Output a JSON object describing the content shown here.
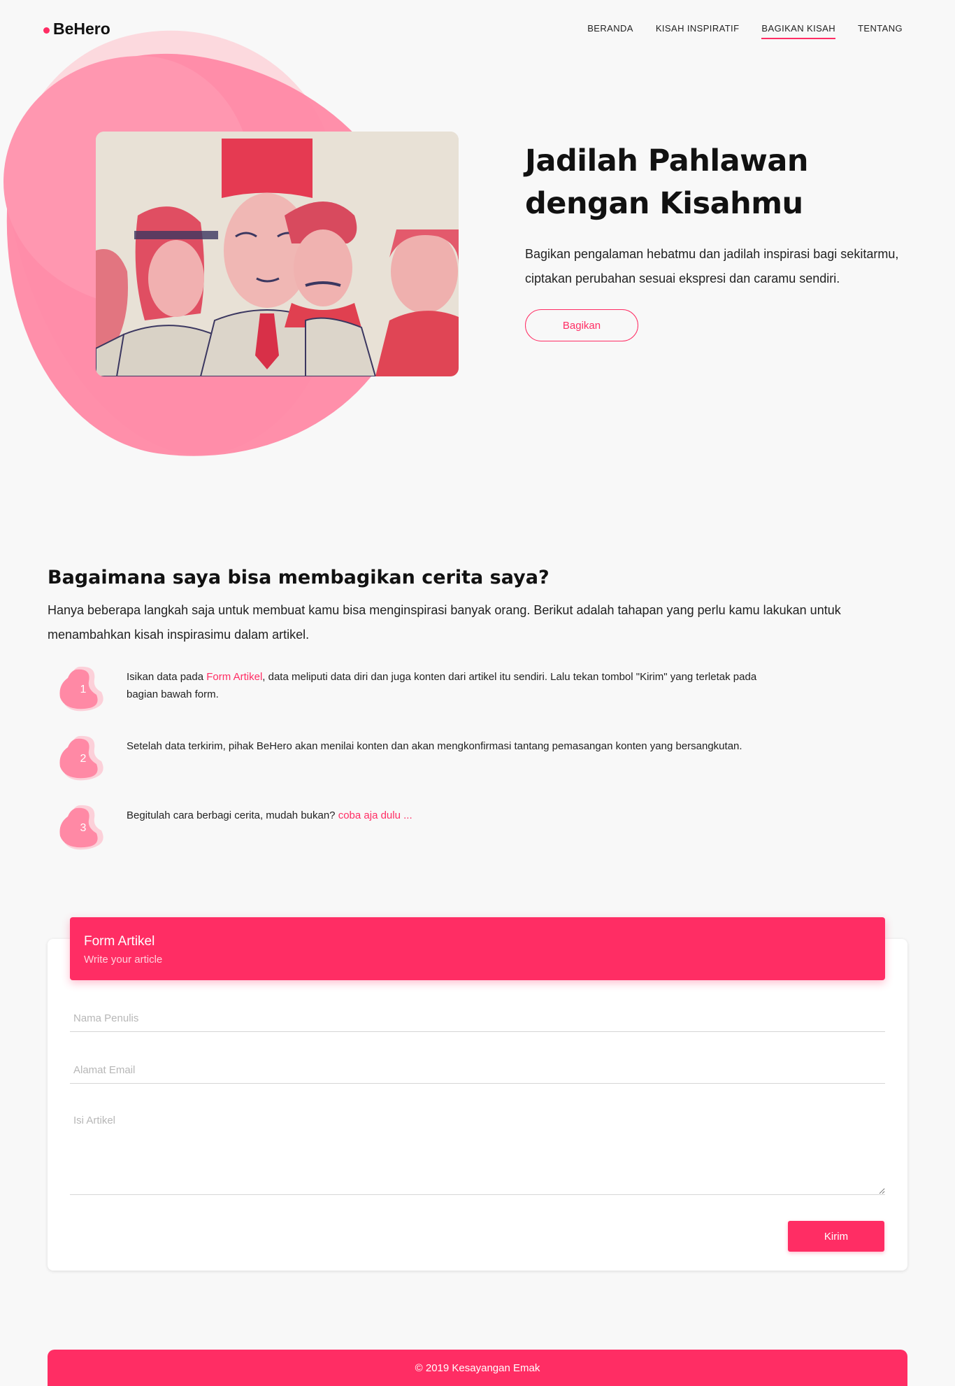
{
  "brand": {
    "name": "BeHero"
  },
  "nav": {
    "items": [
      {
        "label": "BERANDA"
      },
      {
        "label": "KISAH INSPIRATIF"
      },
      {
        "label": "BAGIKAN KISAH"
      },
      {
        "label": "TENTANG"
      }
    ],
    "active": "BAGIKAN KISAH"
  },
  "hero": {
    "title": "Jadilah Pahlawan dengan Kisahmu",
    "description": "Bagikan pengalaman hebatmu dan jadilah inspirasi bagi sekitarmu, ciptakan perubahan sesuai ekspresi dan caramu sendiri.",
    "button_label": "Bagikan"
  },
  "how": {
    "title": "Bagaimana saya bisa membagikan cerita saya?",
    "description": "Hanya beberapa langkah saja untuk membuat kamu bisa menginspirasi banyak orang. Berikut adalah tahapan yang perlu kamu lakukan untuk menambahkan kisah inspirasimu dalam artikel.",
    "steps": [
      {
        "number": "1",
        "text_before": "Isikan data pada ",
        "link": "Form Artikel",
        "text_after": ", data meliputi data diri dan juga konten dari artikel itu sendiri. Lalu tekan tombol \"Kirim\" yang terletak pada bagian bawah form."
      },
      {
        "number": "2",
        "text_before": "Setelah data terkirim, pihak BeHero akan menilai konten dan akan mengkonfirmasi tantang pemasangan konten yang bersangkutan.",
        "link": "",
        "text_after": ""
      },
      {
        "number": "3",
        "text_before": "Begitulah cara berbagi cerita, mudah bukan? ",
        "link": "coba aja dulu ...",
        "text_after": ""
      }
    ]
  },
  "form": {
    "title": "Form Artikel",
    "subtitle": "Write your article",
    "name_placeholder": "Nama Penulis",
    "email_placeholder": "Alamat Email",
    "body_placeholder": "Isi Artikel",
    "submit_label": "Kirim"
  },
  "footer": {
    "text": "© 2019 Kesayangan Emak"
  },
  "colors": {
    "accent": "#ff2d64",
    "blob_light": "#fcd9de",
    "blob_dark": "#ff89a5",
    "background": "#f8f8f8"
  }
}
